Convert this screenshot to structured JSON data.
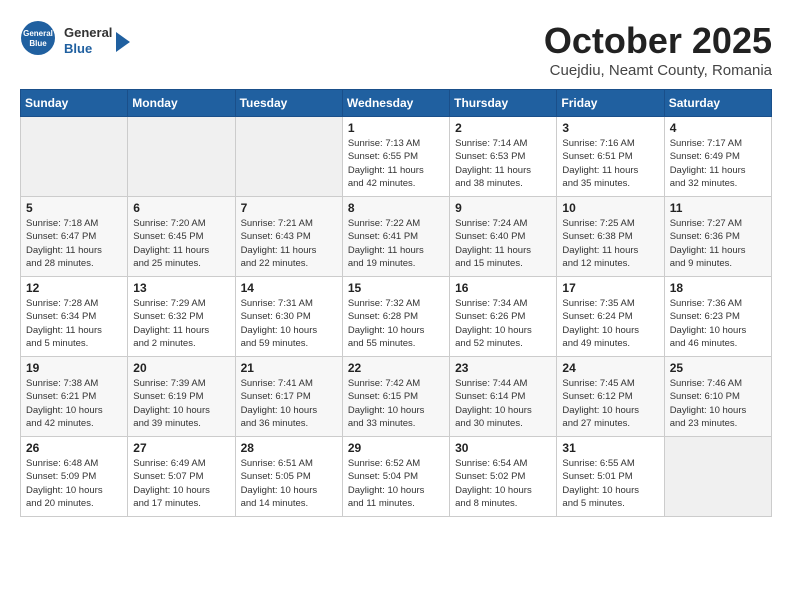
{
  "logo": {
    "general": "General",
    "blue": "Blue",
    "arrow": "▶"
  },
  "header": {
    "month_title": "October 2025",
    "location": "Cuejdiu, Neamt County, Romania"
  },
  "days_of_week": [
    "Sunday",
    "Monday",
    "Tuesday",
    "Wednesday",
    "Thursday",
    "Friday",
    "Saturday"
  ],
  "weeks": [
    [
      {
        "day": "",
        "info": ""
      },
      {
        "day": "",
        "info": ""
      },
      {
        "day": "",
        "info": ""
      },
      {
        "day": "1",
        "info": "Sunrise: 7:13 AM\nSunset: 6:55 PM\nDaylight: 11 hours\nand 42 minutes."
      },
      {
        "day": "2",
        "info": "Sunrise: 7:14 AM\nSunset: 6:53 PM\nDaylight: 11 hours\nand 38 minutes."
      },
      {
        "day": "3",
        "info": "Sunrise: 7:16 AM\nSunset: 6:51 PM\nDaylight: 11 hours\nand 35 minutes."
      },
      {
        "day": "4",
        "info": "Sunrise: 7:17 AM\nSunset: 6:49 PM\nDaylight: 11 hours\nand 32 minutes."
      }
    ],
    [
      {
        "day": "5",
        "info": "Sunrise: 7:18 AM\nSunset: 6:47 PM\nDaylight: 11 hours\nand 28 minutes."
      },
      {
        "day": "6",
        "info": "Sunrise: 7:20 AM\nSunset: 6:45 PM\nDaylight: 11 hours\nand 25 minutes."
      },
      {
        "day": "7",
        "info": "Sunrise: 7:21 AM\nSunset: 6:43 PM\nDaylight: 11 hours\nand 22 minutes."
      },
      {
        "day": "8",
        "info": "Sunrise: 7:22 AM\nSunset: 6:41 PM\nDaylight: 11 hours\nand 19 minutes."
      },
      {
        "day": "9",
        "info": "Sunrise: 7:24 AM\nSunset: 6:40 PM\nDaylight: 11 hours\nand 15 minutes."
      },
      {
        "day": "10",
        "info": "Sunrise: 7:25 AM\nSunset: 6:38 PM\nDaylight: 11 hours\nand 12 minutes."
      },
      {
        "day": "11",
        "info": "Sunrise: 7:27 AM\nSunset: 6:36 PM\nDaylight: 11 hours\nand 9 minutes."
      }
    ],
    [
      {
        "day": "12",
        "info": "Sunrise: 7:28 AM\nSunset: 6:34 PM\nDaylight: 11 hours\nand 5 minutes."
      },
      {
        "day": "13",
        "info": "Sunrise: 7:29 AM\nSunset: 6:32 PM\nDaylight: 11 hours\nand 2 minutes."
      },
      {
        "day": "14",
        "info": "Sunrise: 7:31 AM\nSunset: 6:30 PM\nDaylight: 10 hours\nand 59 minutes."
      },
      {
        "day": "15",
        "info": "Sunrise: 7:32 AM\nSunset: 6:28 PM\nDaylight: 10 hours\nand 55 minutes."
      },
      {
        "day": "16",
        "info": "Sunrise: 7:34 AM\nSunset: 6:26 PM\nDaylight: 10 hours\nand 52 minutes."
      },
      {
        "day": "17",
        "info": "Sunrise: 7:35 AM\nSunset: 6:24 PM\nDaylight: 10 hours\nand 49 minutes."
      },
      {
        "day": "18",
        "info": "Sunrise: 7:36 AM\nSunset: 6:23 PM\nDaylight: 10 hours\nand 46 minutes."
      }
    ],
    [
      {
        "day": "19",
        "info": "Sunrise: 7:38 AM\nSunset: 6:21 PM\nDaylight: 10 hours\nand 42 minutes."
      },
      {
        "day": "20",
        "info": "Sunrise: 7:39 AM\nSunset: 6:19 PM\nDaylight: 10 hours\nand 39 minutes."
      },
      {
        "day": "21",
        "info": "Sunrise: 7:41 AM\nSunset: 6:17 PM\nDaylight: 10 hours\nand 36 minutes."
      },
      {
        "day": "22",
        "info": "Sunrise: 7:42 AM\nSunset: 6:15 PM\nDaylight: 10 hours\nand 33 minutes."
      },
      {
        "day": "23",
        "info": "Sunrise: 7:44 AM\nSunset: 6:14 PM\nDaylight: 10 hours\nand 30 minutes."
      },
      {
        "day": "24",
        "info": "Sunrise: 7:45 AM\nSunset: 6:12 PM\nDaylight: 10 hours\nand 27 minutes."
      },
      {
        "day": "25",
        "info": "Sunrise: 7:46 AM\nSunset: 6:10 PM\nDaylight: 10 hours\nand 23 minutes."
      }
    ],
    [
      {
        "day": "26",
        "info": "Sunrise: 6:48 AM\nSunset: 5:09 PM\nDaylight: 10 hours\nand 20 minutes."
      },
      {
        "day": "27",
        "info": "Sunrise: 6:49 AM\nSunset: 5:07 PM\nDaylight: 10 hours\nand 17 minutes."
      },
      {
        "day": "28",
        "info": "Sunrise: 6:51 AM\nSunset: 5:05 PM\nDaylight: 10 hours\nand 14 minutes."
      },
      {
        "day": "29",
        "info": "Sunrise: 6:52 AM\nSunset: 5:04 PM\nDaylight: 10 hours\nand 11 minutes."
      },
      {
        "day": "30",
        "info": "Sunrise: 6:54 AM\nSunset: 5:02 PM\nDaylight: 10 hours\nand 8 minutes."
      },
      {
        "day": "31",
        "info": "Sunrise: 6:55 AM\nSunset: 5:01 PM\nDaylight: 10 hours\nand 5 minutes."
      },
      {
        "day": "",
        "info": ""
      }
    ]
  ]
}
